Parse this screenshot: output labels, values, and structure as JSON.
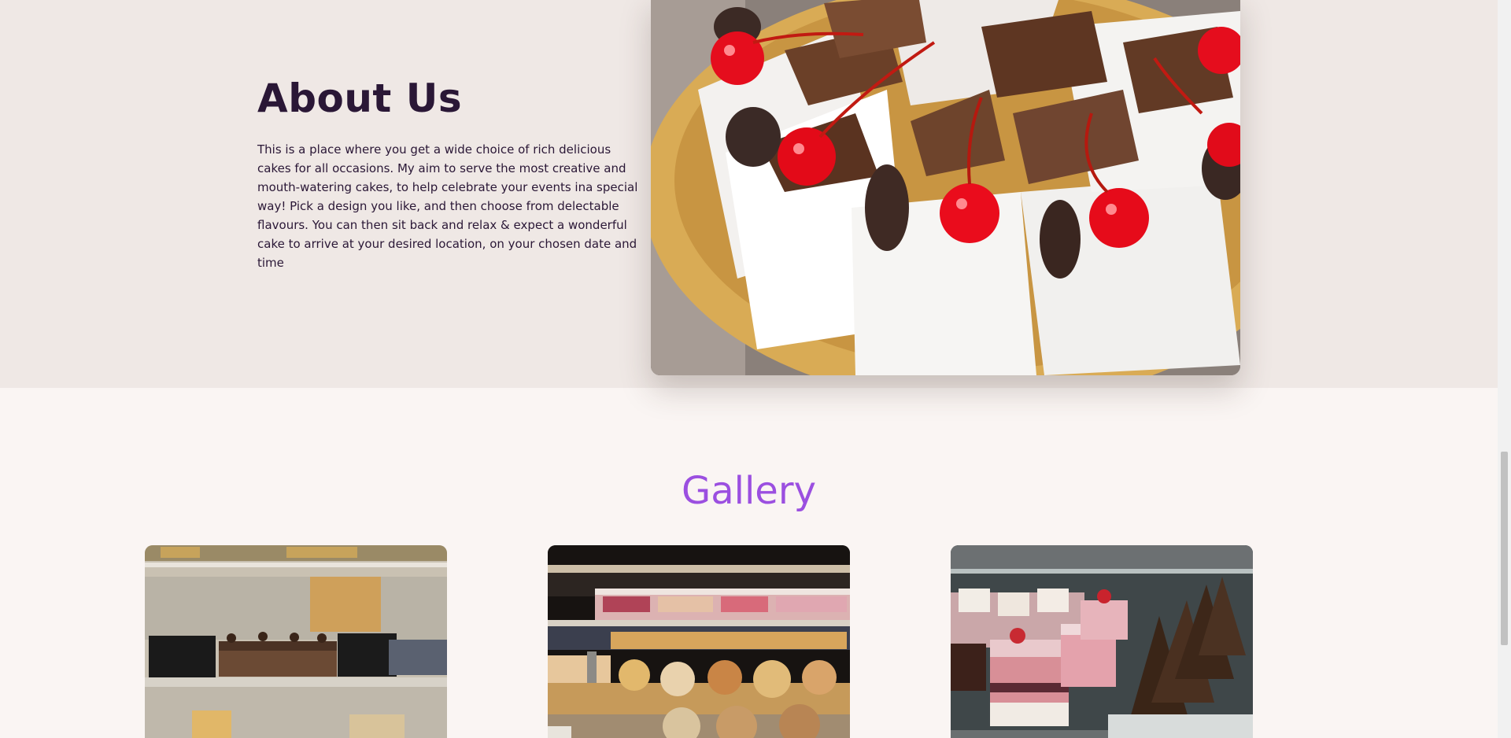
{
  "about": {
    "title": "About Us",
    "text": "This is a place where you get a wide choice of rich delicious cakes for all occasions. My aim to serve the most creative and mouth-watering cakes, to help celebrate your events ina special way! Pick a design you like, and then choose from delectable flavours. You can then sit back and relax & expect a wonderful cake to arrive at your desired location, on your chosen date and time"
  },
  "gallery": {
    "title": "Gallery"
  },
  "colors": {
    "about_bg": "#efe8e5",
    "page_bg": "#faf5f3",
    "heading_dark": "#2a1736",
    "gallery_accent": "#9b4fe0"
  }
}
